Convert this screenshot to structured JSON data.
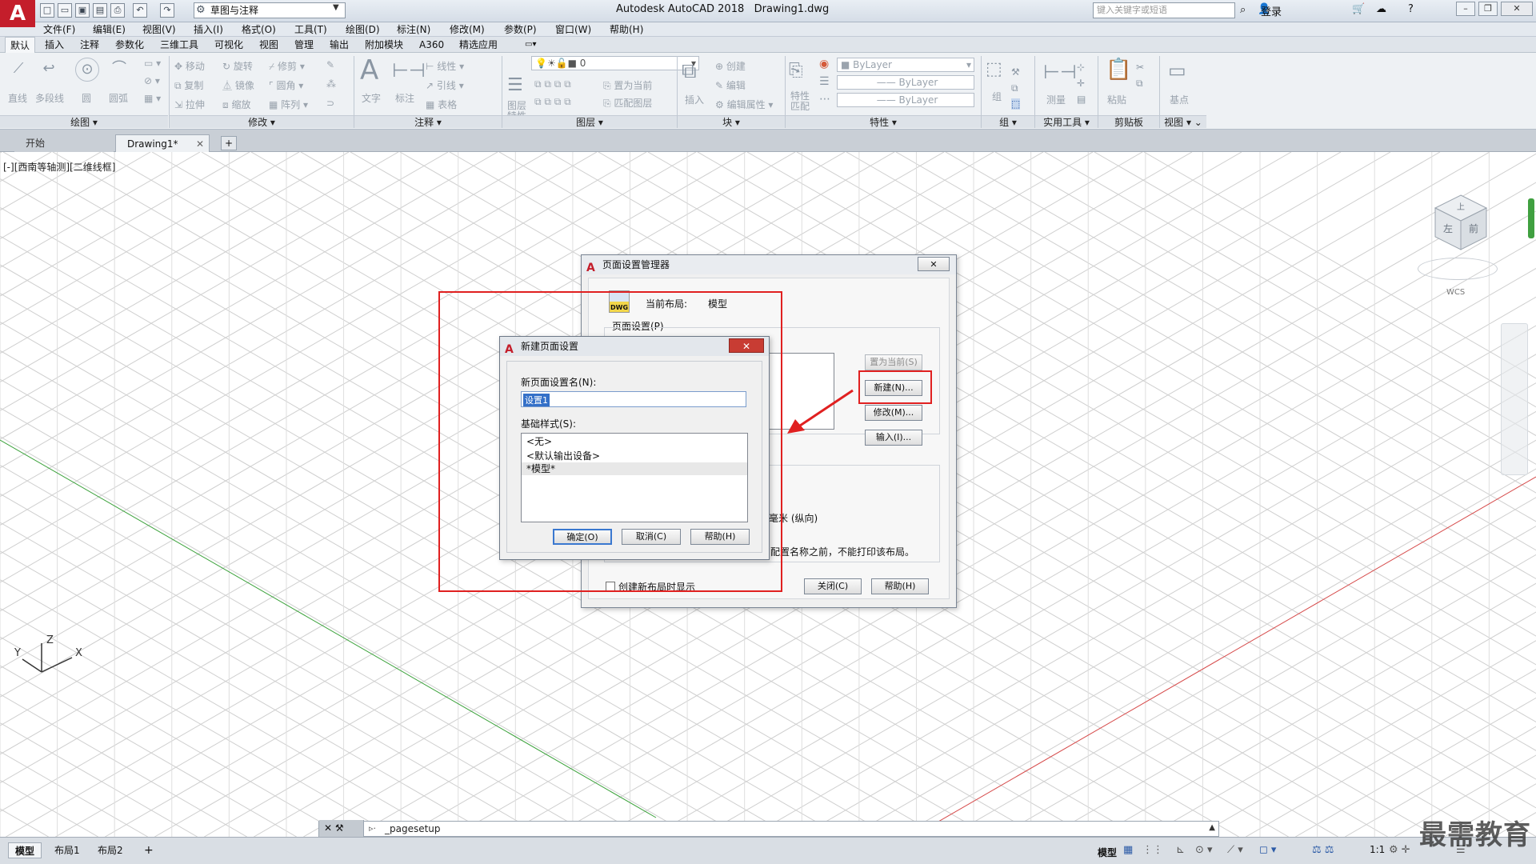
{
  "app": {
    "title": "Autodesk AutoCAD 2018",
    "document": "Drawing1.dwg",
    "logo": "A",
    "workspace": "草图与注释",
    "search_placeholder": "键入关键字或短语",
    "login": "登录"
  },
  "menubar": [
    "文件(F)",
    "编辑(E)",
    "视图(V)",
    "插入(I)",
    "格式(O)",
    "工具(T)",
    "绘图(D)",
    "标注(N)",
    "修改(M)",
    "参数(P)",
    "窗口(W)",
    "帮助(H)"
  ],
  "ribbon_tabs": [
    "默认",
    "插入",
    "注释",
    "参数化",
    "三维工具",
    "可视化",
    "视图",
    "管理",
    "输出",
    "附加模块",
    "A360",
    "精选应用"
  ],
  "ribbon": {
    "draw": {
      "title": "绘图",
      "tools": [
        "直线",
        "多段线",
        "圆",
        "圆弧"
      ]
    },
    "modify": {
      "title": "修改",
      "tools": [
        "移动",
        "旋转",
        "修剪",
        "复制",
        "镜像",
        "圆角",
        "拉伸",
        "缩放",
        "阵列"
      ]
    },
    "annotation": {
      "title": "注释",
      "tools": [
        "文字",
        "标注",
        "线性",
        "引线",
        "表格"
      ]
    },
    "layers": {
      "title": "图层",
      "tools": [
        "图层特性",
        "置为当前",
        "匹配图层"
      ],
      "current_layer": "0"
    },
    "block": {
      "title": "块",
      "tools": [
        "插入",
        "创建",
        "编辑",
        "编辑属性"
      ]
    },
    "properties": {
      "title": "特性",
      "tools": [
        "特性匹配"
      ],
      "color": "ByLayer",
      "linetype": "ByLayer",
      "lineweight": "ByLayer"
    },
    "groups": {
      "title": "组",
      "tools": [
        "组"
      ]
    },
    "utilities": {
      "title": "实用工具",
      "tools": [
        "测量"
      ]
    },
    "clipboard": {
      "title": "剪贴板",
      "tools": [
        "粘贴"
      ]
    },
    "view": {
      "title": "视图",
      "tools": [
        "基点"
      ]
    }
  },
  "doc_tabs": [
    "开始",
    "Drawing1*"
  ],
  "viewport_label": "[-][西南等轴测][二维线框]",
  "viewcube": {
    "faces": [
      "上",
      "前",
      "左"
    ],
    "wcs": "WCS"
  },
  "ucs": {
    "x": "X",
    "y": "Y",
    "z": "Z"
  },
  "page_setup_manager": {
    "title": "页面设置管理器",
    "current_layout_label": "当前布局:",
    "current_layout_value": "模型",
    "dwg_badge": "DWG",
    "page_setups_label": "页面设置(P)",
    "buttons": {
      "set_current": "置为当前(S)",
      "new": "新建(N)...",
      "modify": "修改(M)...",
      "import": "输入(I)..."
    },
    "details_size": "毫米 (纵向)",
    "details_note": "配置名称之前，不能打印该布局。",
    "show_on_create": "创建新布局时显示",
    "close": "关闭(C)",
    "help": "帮助(H)"
  },
  "new_page_setup": {
    "title": "新建页面设置",
    "name_label": "新页面设置名(N):",
    "name_value": "设置1",
    "base_style_label": "基础样式(S):",
    "styles": [
      "<无>",
      "<默认输出设备>",
      "*模型*"
    ],
    "selected_style": "*模型*",
    "ok": "确定(O)",
    "cancel": "取消(C)",
    "help": "帮助(H)"
  },
  "command": {
    "text": "_pagesetup"
  },
  "status": {
    "tabs": [
      "模型",
      "布局1",
      "布局2"
    ],
    "model": "模型",
    "scale": "1:1"
  },
  "watermark": "最需教育",
  "colors": {
    "accent_red": "#e02020",
    "grid_line": "#c8c8c8",
    "x_axis": "#d64a4a",
    "y_axis": "#3aa13a",
    "autocad_red": "#c41e2b"
  }
}
